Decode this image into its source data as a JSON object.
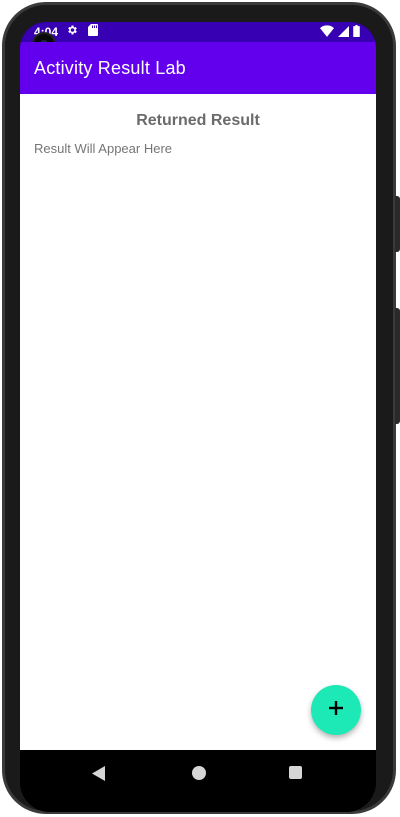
{
  "status_bar": {
    "time": "4:04",
    "icons": [
      "settings-icon",
      "sd-card-icon",
      "wifi-icon",
      "signal-icon",
      "battery-icon"
    ],
    "background": "#3700B3"
  },
  "app_bar": {
    "title": "Activity Result Lab",
    "background": "#6200EE"
  },
  "main": {
    "heading": "Returned Result",
    "result_text": "Result Will Appear Here"
  },
  "fab": {
    "icon": "plus-icon",
    "color": "#1DE9B6"
  },
  "nav_bar": {
    "icons": [
      "back-icon",
      "home-icon",
      "recents-icon"
    ]
  }
}
